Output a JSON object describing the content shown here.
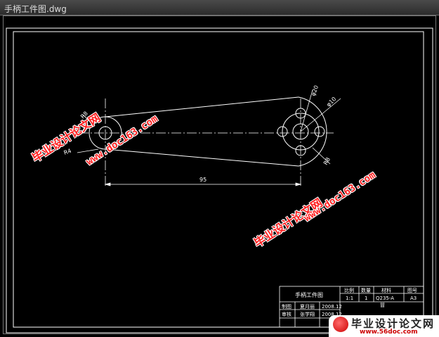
{
  "window": {
    "title": "手柄工件图.dwg"
  },
  "drawing": {
    "dimensions": {
      "length": "95",
      "r_left": "R8",
      "r_left_small": "R4",
      "dia_hole": "φ20",
      "dia_outer": "φ10",
      "r_right": "R8"
    },
    "title_block": {
      "part_name": "手柄工件图",
      "scale_label": "比例",
      "scale_value": "1:1",
      "qty_label": "数量",
      "qty_value": "1",
      "material_label": "材料",
      "material_value": "Q235-A",
      "drawing_no_label": "图号",
      "drawing_no_value": "A3",
      "extra": "冒",
      "drawn_label": "制图",
      "drawn_name": "夏月丽",
      "drawn_date": "2008.12",
      "checked_label": "审核",
      "checked_name": "张学翔",
      "checked_date": "2008.12"
    }
  },
  "watermarks": {
    "site_cn": "毕业设计论文网",
    "site_url": "www.doc163.com"
  },
  "logo": {
    "cn": "毕业设计论文网",
    "url": "www.56doc.com"
  },
  "colors": {
    "line": "#ffffff",
    "background": "#000000",
    "watermark": "#ff2020"
  }
}
